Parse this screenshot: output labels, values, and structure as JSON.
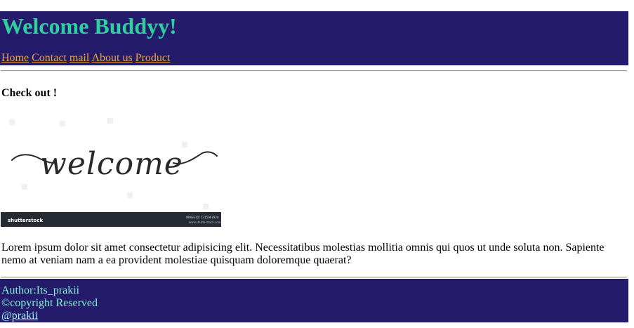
{
  "header": {
    "title": "Welcome Buddyy!",
    "nav": [
      {
        "label": "Home"
      },
      {
        "label": "Contact"
      },
      {
        "label": "mail"
      },
      {
        "label": "About us"
      },
      {
        "label": "Product"
      }
    ]
  },
  "main": {
    "heading": "Check out !",
    "image": {
      "script_text": "welcome",
      "watermark_brand": "shutterstock",
      "image_id_text": "IMAGE ID: 1715967820",
      "site_text": "www.shutterstock.com"
    },
    "paragraph": "Lorem ipsum dolor sit amet consectetur adipisicing elit. Necessitatibus molestias mollitia omnis qui quos ut unde soluta non. Sapiente nemo at veniam nam a ea provident molestiae quisquam doloremque quaerat?"
  },
  "footer": {
    "author": "Author:Its_prakii",
    "copyright": "©copyright Reserved",
    "handle": "@prakii"
  },
  "colors": {
    "band_bg": "#251b6b",
    "title_color": "#2ecf9e",
    "nav_link_color": "#e8a33d",
    "footer_text_color": "#7ff0d8",
    "footer_handle_color": "#9ff5ff"
  }
}
